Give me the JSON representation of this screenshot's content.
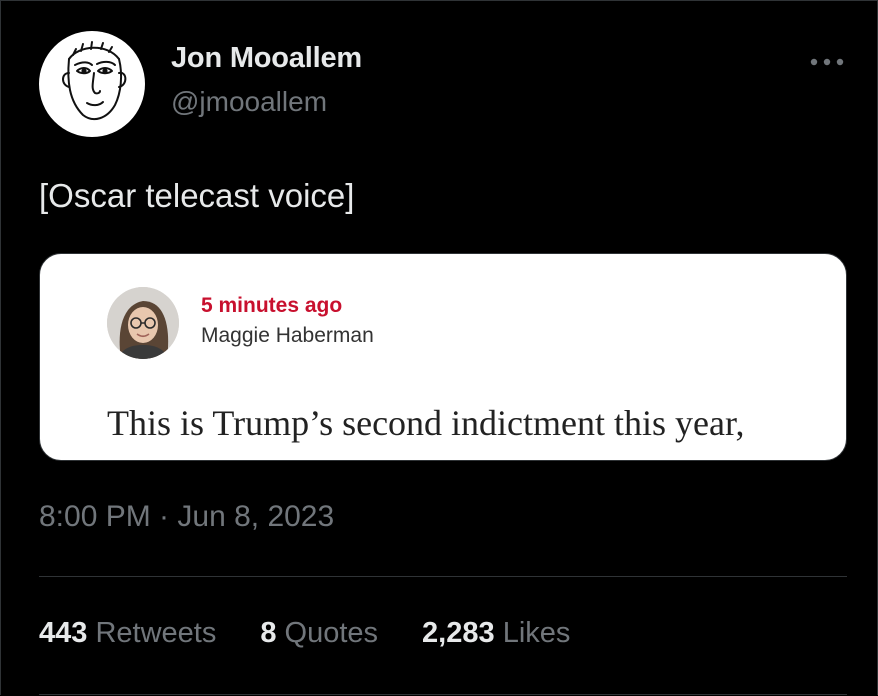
{
  "author": {
    "name": "Jon Mooallem",
    "handle": "@jmooallem"
  },
  "tweet": {
    "text": "[Oscar telecast voice]",
    "timestamp": "8:00 PM · Jun 8, 2023"
  },
  "media": {
    "time_ago": "5 minutes ago",
    "byline": "Maggie Haberman",
    "headline": "This is Trump’s second indictment this year,"
  },
  "stats": {
    "retweets": {
      "count": "443",
      "label": "Retweets"
    },
    "quotes": {
      "count": "8",
      "label": "Quotes"
    },
    "likes": {
      "count": "2,283",
      "label": "Likes"
    }
  },
  "icons": {
    "more": "more-horizontal-icon"
  },
  "colors": {
    "background": "#000000",
    "primary_text": "#e7e9ea",
    "secondary_text": "#71767b",
    "divider": "#2f3336",
    "card_time_red": "#c8102e"
  }
}
